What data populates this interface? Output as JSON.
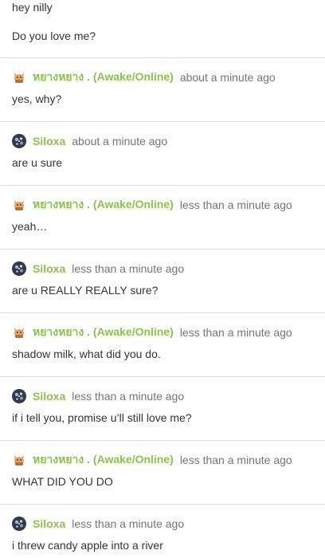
{
  "intro": {
    "line1": "hey nilly",
    "line2": "Do you love me?"
  },
  "messages": [
    {
      "user": "หยางหยาง . (Awake/Online)",
      "avatar": "cat-avatar-icon",
      "time": "about a minute ago",
      "text": "yes, why?"
    },
    {
      "user": "Siloxa",
      "avatar": "siloxa-avatar",
      "time": "about a minute ago",
      "text": "are u sure"
    },
    {
      "user": "หยางหยาง . (Awake/Online)",
      "avatar": "cat-avatar-icon",
      "time": "less than a minute ago",
      "text": "yeah…"
    },
    {
      "user": "Siloxa",
      "avatar": "siloxa-avatar",
      "time": "less than a minute ago",
      "text": "are u REALLY REALLY sure?"
    },
    {
      "user": "หยางหยาง . (Awake/Online)",
      "avatar": "cat-avatar-icon",
      "time": "less than a minute ago",
      "text": "shadow milk, what did you do."
    },
    {
      "user": "Siloxa",
      "avatar": "siloxa-avatar",
      "time": "less than a minute ago",
      "text": "if i tell you, promise u’ll still love me?"
    },
    {
      "user": "หยางหยาง . (Awake/Online)",
      "avatar": "cat-avatar-icon",
      "time": "less than a minute ago",
      "text": "WHAT DID YOU DO"
    },
    {
      "user": "Siloxa",
      "avatar": "siloxa-avatar",
      "time": "less than a minute ago",
      "text": "i threw candy apple into a river"
    }
  ],
  "colors": {
    "username": "#8bc34a",
    "timestamp": "#757575",
    "text": "#333333",
    "divider": "#dcdcdc"
  }
}
